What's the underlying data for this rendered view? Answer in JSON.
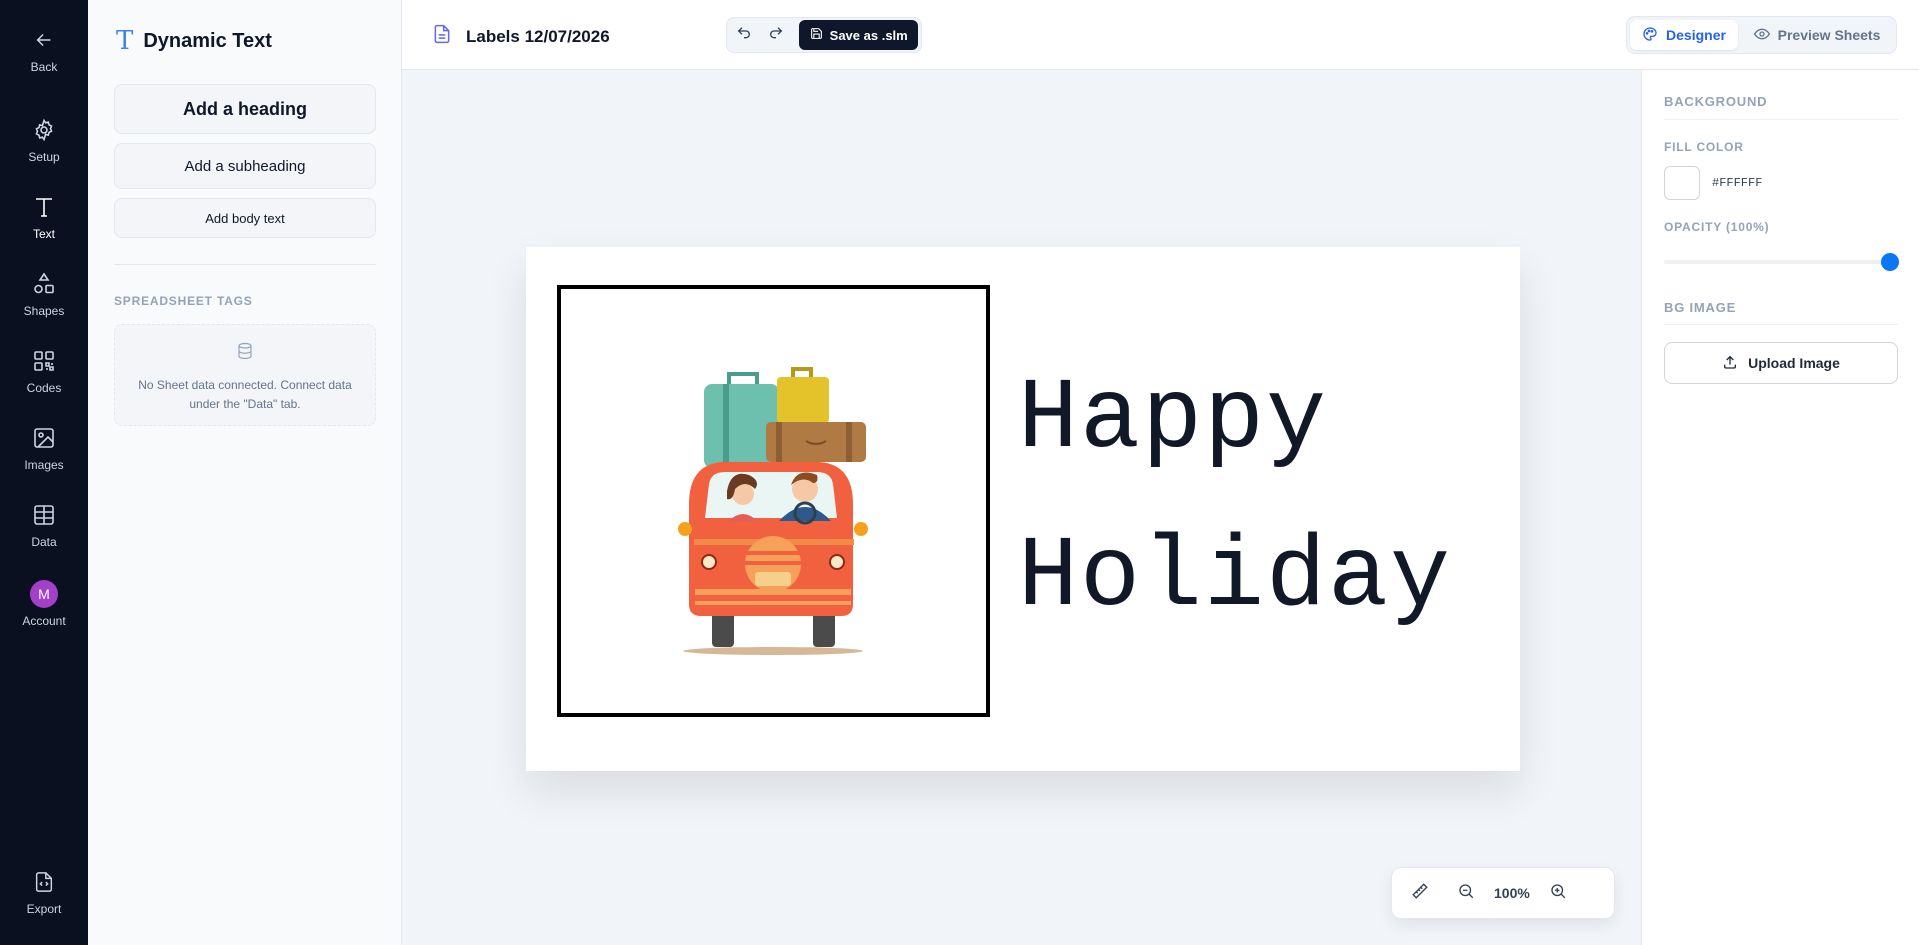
{
  "rail": {
    "back": "Back",
    "setup": "Setup",
    "text": "Text",
    "shapes": "Shapes",
    "codes": "Codes",
    "images": "Images",
    "data": "Data",
    "account": "Account",
    "account_initial": "M",
    "export": "Export",
    "active": "text"
  },
  "panel": {
    "title": "Dynamic Text",
    "add_heading": "Add a heading",
    "add_subheading": "Add a subheading",
    "add_body": "Add body text",
    "tags_label": "SPREADSHEET TAGS",
    "tags_message": "No Sheet data connected. Connect data under the \"Data\" tab."
  },
  "topbar": {
    "doc_title": "Labels 12/07/2026",
    "save_label": "Save as .slm",
    "designer_label": "Designer",
    "preview_label": "Preview Sheets",
    "active_mode": "designer"
  },
  "canvas": {
    "text_line1": "Happy",
    "text_line2": "Holiday",
    "zoom": "100%",
    "background": "#FFFFFF"
  },
  "right_panel": {
    "background_label": "BACKGROUND",
    "fill_label": "FILL COLOR",
    "fill_value": "#FFFFFF",
    "opacity_label": "OPACITY (100%)",
    "opacity": 1.0,
    "bg_image_label": "BG IMAGE",
    "upload_label": "Upload Image"
  },
  "colors": {
    "accent": "#2563eb",
    "rail_bg": "#0b1020",
    "slider_thumb": "#0a77f5",
    "avatar": "#a43fc9"
  }
}
